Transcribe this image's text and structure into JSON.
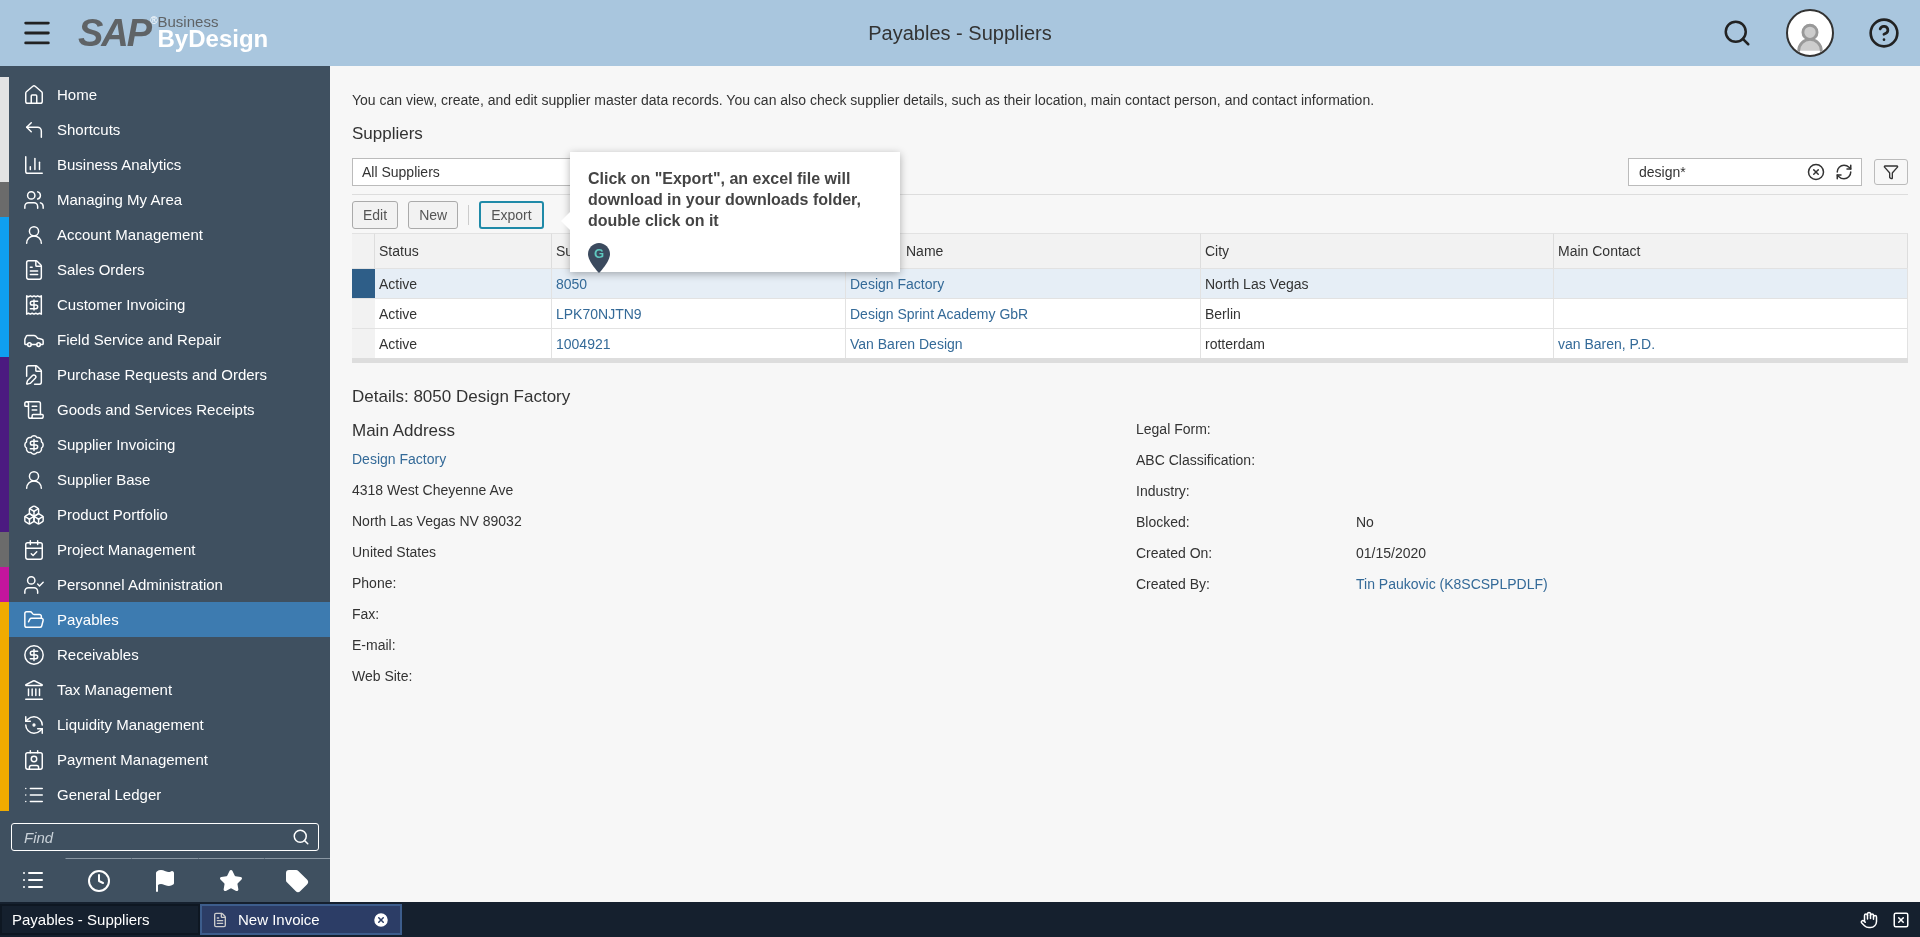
{
  "header": {
    "logo": {
      "brand": "SAP",
      "mark": "®",
      "superscript": "Business",
      "product": "ByDesign"
    },
    "title": "Payables - Suppliers"
  },
  "sidebar": {
    "items": [
      {
        "label": "Home",
        "color": "#e3e3e3",
        "selected": false
      },
      {
        "label": "Shortcuts",
        "color": "#e3e3e3",
        "selected": false
      },
      {
        "label": "Business Analytics",
        "color": "#e3e3e3",
        "selected": false
      },
      {
        "label": "Managing My Area",
        "color": "#6b6b6b",
        "selected": false
      },
      {
        "label": "Account Management",
        "color": "#0f9ff0",
        "selected": false
      },
      {
        "label": "Sales Orders",
        "color": "#0f9ff0",
        "selected": false
      },
      {
        "label": "Customer Invoicing",
        "color": "#0f9ff0",
        "selected": false
      },
      {
        "label": "Field Service and Repair",
        "color": "#0f9ff0",
        "selected": false
      },
      {
        "label": "Purchase Requests and Orders",
        "color": "#4b1a80",
        "selected": false
      },
      {
        "label": "Goods and Services Receipts",
        "color": "#4b1a80",
        "selected": false
      },
      {
        "label": "Supplier Invoicing",
        "color": "#4b1a80",
        "selected": false
      },
      {
        "label": "Supplier Base",
        "color": "#4b1a80",
        "selected": false
      },
      {
        "label": "Product Portfolio",
        "color": "#4b1a80",
        "selected": false
      },
      {
        "label": "Project Management",
        "color": "#6b6b6b",
        "selected": false
      },
      {
        "label": "Personnel Administration",
        "color": "#c4159d",
        "selected": false
      },
      {
        "label": "Payables",
        "color": "#f0ab00",
        "selected": true
      },
      {
        "label": "Receivables",
        "color": "#f0ab00",
        "selected": false
      },
      {
        "label": "Tax Management",
        "color": "#f0ab00",
        "selected": false
      },
      {
        "label": "Liquidity Management",
        "color": "#f0ab00",
        "selected": false
      },
      {
        "label": "Payment Management",
        "color": "#f0ab00",
        "selected": false
      },
      {
        "label": "General Ledger",
        "color": "#f0ab00",
        "selected": false
      }
    ],
    "find": {
      "placeholder": "Find"
    },
    "bottom_tabs": [
      {
        "selected": true
      },
      {
        "selected": false
      },
      {
        "selected": false
      },
      {
        "selected": false
      },
      {
        "selected": false
      }
    ]
  },
  "content": {
    "description": "You can view, create, and edit supplier master data records. You can also check supplier details, such as their location, main contact person, and contact information.",
    "section_title": "Suppliers",
    "view_select": "All Suppliers",
    "search": {
      "value": "design*"
    },
    "buttons": [
      {
        "label": "Edit",
        "focused": false
      },
      {
        "label": "New",
        "focused": false
      },
      {
        "label": "Export",
        "focused": true
      }
    ],
    "tooltip": {
      "text": "Click on \"Export\", an excel file will download in your downloads folder, double click on it",
      "marker_letter": "G"
    },
    "table": {
      "columns": [
        "Status",
        "Su",
        "Name",
        "City",
        "Main Contact"
      ],
      "rows": [
        {
          "selected": true,
          "cells": [
            "Active",
            "8050",
            "Design Factory",
            "North Las Vegas",
            ""
          ]
        },
        {
          "selected": false,
          "cells": [
            "Active",
            "LPK70NJTN9",
            "Design Sprint Academy GbR",
            "Berlin",
            ""
          ]
        },
        {
          "selected": false,
          "cells": [
            "Active",
            "1004921",
            "Van Baren Design",
            "rotterdam",
            "van Baren, P.D."
          ]
        }
      ]
    },
    "details": {
      "title": "Details: 8050 Design Factory",
      "address_title": "Main Address",
      "address": [
        {
          "text": "Design Factory",
          "kind": "link"
        },
        {
          "text": "4318 West Cheyenne Ave",
          "kind": "text"
        },
        {
          "text": "North Las Vegas NV  89032",
          "kind": "text"
        },
        {
          "text": "United States",
          "kind": "text"
        },
        {
          "text": "Phone:",
          "kind": "label"
        },
        {
          "text": "Fax:",
          "kind": "label"
        },
        {
          "text": "E-mail:",
          "kind": "label"
        },
        {
          "text": "Web Site:",
          "kind": "label"
        }
      ],
      "fields": [
        {
          "label": "Legal Form:"
        },
        {
          "label": "ABC Classification:"
        },
        {
          "label": "Industry:"
        },
        {
          "label": "Blocked:",
          "value": "No",
          "kind": "text"
        },
        {
          "label": "Created On:",
          "value": "01/15/2020",
          "kind": "text"
        },
        {
          "label": "Created By:",
          "value": "Tin Paukovic (K8SCSPLPDLF)",
          "kind": "link"
        }
      ]
    }
  },
  "taskbar": {
    "tabs": [
      {
        "label": "Payables - Suppliers",
        "selected": false,
        "closable": false
      },
      {
        "label": "New Invoice",
        "selected": true,
        "closable": true
      }
    ]
  }
}
